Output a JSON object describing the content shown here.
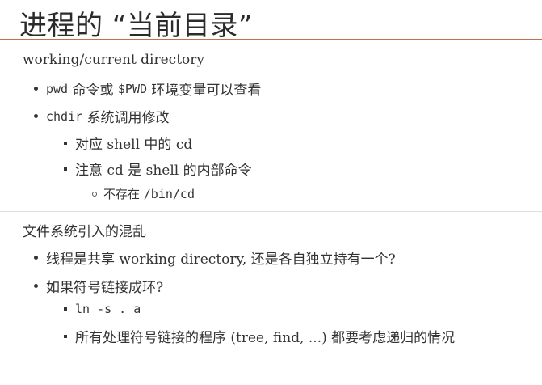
{
  "title": "进程的 “当前目录”",
  "section1": {
    "heading": "working/current directory",
    "item1": {
      "code1": "pwd",
      "text1": " 命令或 ",
      "code2": "$PWD",
      "text2": " 环境变量可以查看"
    },
    "item2": {
      "code": "chdir",
      "text": " 系统调用修改"
    },
    "item2a": {
      "text": "对应 shell 中的 cd"
    },
    "item2b": {
      "text": "注意 cd 是 shell 的内部命令"
    },
    "item2b1": {
      "text": "不存在 ",
      "code": "/bin/cd"
    }
  },
  "section2": {
    "heading": "文件系统引入的混乱",
    "item1": {
      "text": "线程是共享 working directory, 还是各自独立持有一个?"
    },
    "item2": {
      "text": "如果符号链接成环?"
    },
    "item2a": {
      "code": "ln -s . a"
    },
    "item2b": {
      "text": "所有处理符号链接的程序 (tree, find, ...) 都要考虑递归的情况"
    }
  }
}
